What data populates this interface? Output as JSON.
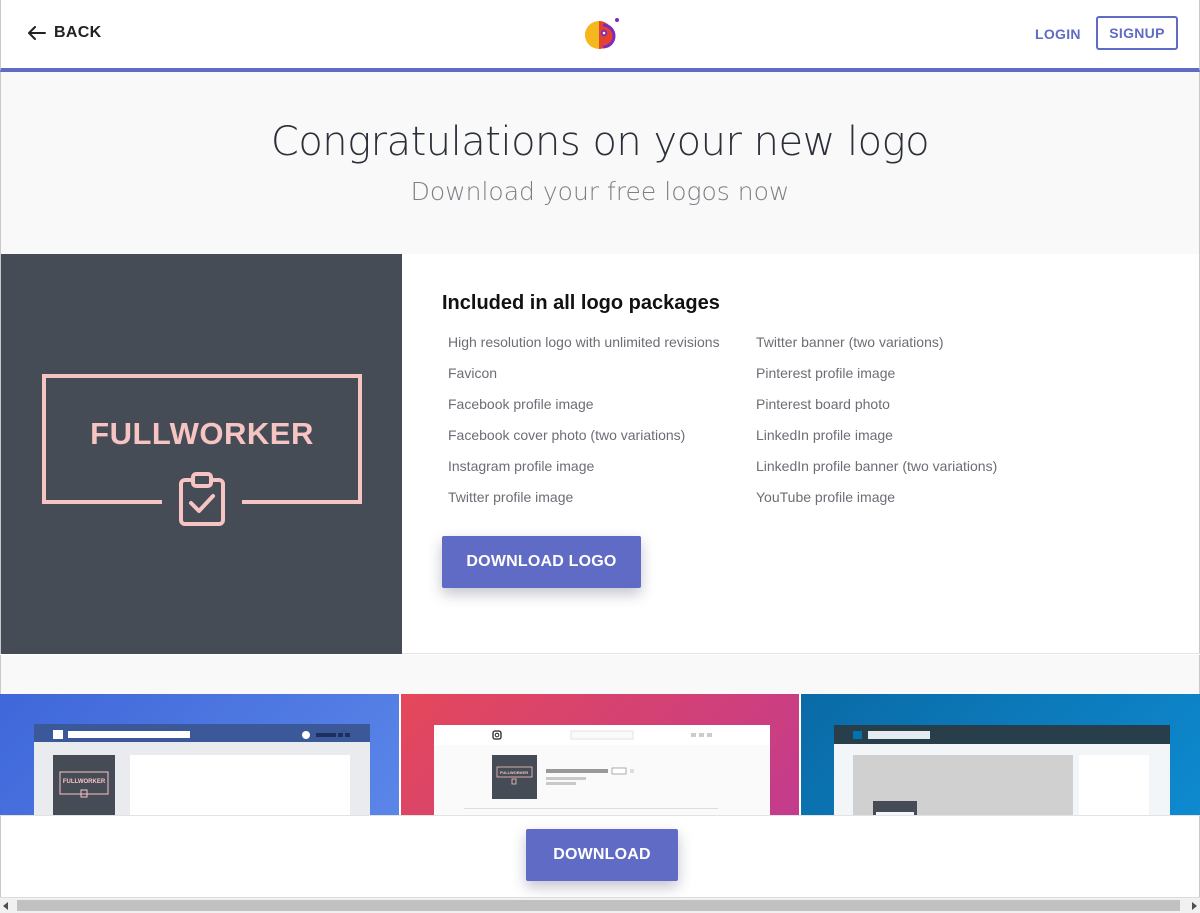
{
  "header": {
    "back_label": "BACK",
    "login_label": "LOGIN",
    "signup_label": "SIGNUP"
  },
  "hero": {
    "title": "Congratulations on your new logo",
    "subtitle": "Download your free logos now"
  },
  "logo": {
    "name": "FULLWORKER",
    "icon": "clipboard-check-icon",
    "background_color": "#464c56",
    "accent_color": "#f7c4c4"
  },
  "package": {
    "title": "Included in all logo packages",
    "features_left": [
      "High resolution logo with unlimited revisions",
      "Favicon",
      "Facebook profile image",
      "Facebook cover photo (two variations)",
      "Instagram profile image",
      "Twitter profile image"
    ],
    "features_right": [
      "Twitter banner (two variations)",
      "Pinterest profile image",
      "Pinterest board photo",
      "LinkedIn profile image",
      "LinkedIn profile banner (two variations)",
      "YouTube profile image"
    ],
    "download_logo_label": "DOWNLOAD LOGO"
  },
  "mockups": {
    "facebook_logo_text": "FULLWORKER",
    "instagram_logo_text": "FULLWORKER"
  },
  "footer": {
    "download_label": "DOWNLOAD"
  },
  "colors": {
    "primary": "#5f6bc4",
    "facebook_bg": "#3f67d9",
    "instagram_bg": "#e5485a",
    "linkedin_bg": "#0a6aa6"
  }
}
